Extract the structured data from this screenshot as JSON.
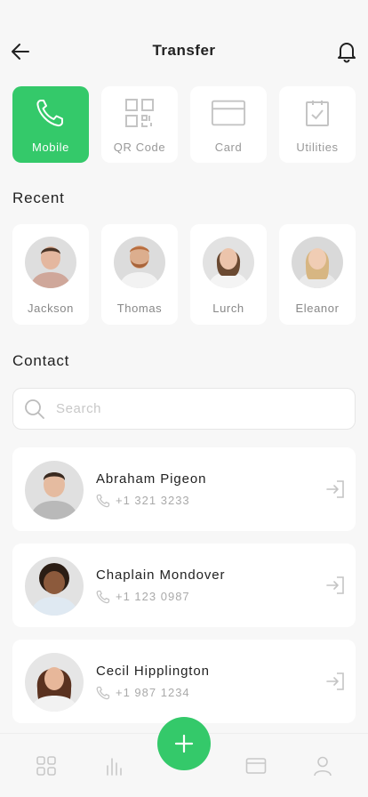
{
  "header": {
    "title": "Transfer",
    "back_icon": "arrow-left-icon",
    "bell_icon": "bell-icon"
  },
  "tiles": [
    {
      "label": "Mobile",
      "icon": "phone-icon",
      "active": true
    },
    {
      "label": "QR Code",
      "icon": "qr-code-icon",
      "active": false
    },
    {
      "label": "Card",
      "icon": "card-icon",
      "active": false
    },
    {
      "label": "Utilities",
      "icon": "clipboard-check-icon",
      "active": false
    }
  ],
  "recent": {
    "title": "Recent",
    "people": [
      {
        "name": "Jackson"
      },
      {
        "name": "Thomas"
      },
      {
        "name": "Lurch"
      },
      {
        "name": "Eleanor"
      }
    ]
  },
  "contact": {
    "title": "Contact",
    "search_placeholder": "Search",
    "items": [
      {
        "name": "Abraham Pigeon",
        "phone": "+1 321 3233"
      },
      {
        "name": "Chaplain Mondover",
        "phone": "+1 123 0987"
      },
      {
        "name": "Cecil Hipplington",
        "phone": "+1 987 1234"
      }
    ]
  },
  "bottom_nav": {
    "items": [
      "grid-icon",
      "chart-icon",
      "card-icon",
      "user-icon"
    ],
    "fab_icon": "plus-icon"
  },
  "colors": {
    "accent": "#34c96a",
    "background": "#f7f7f7",
    "muted_text": "#999999"
  }
}
